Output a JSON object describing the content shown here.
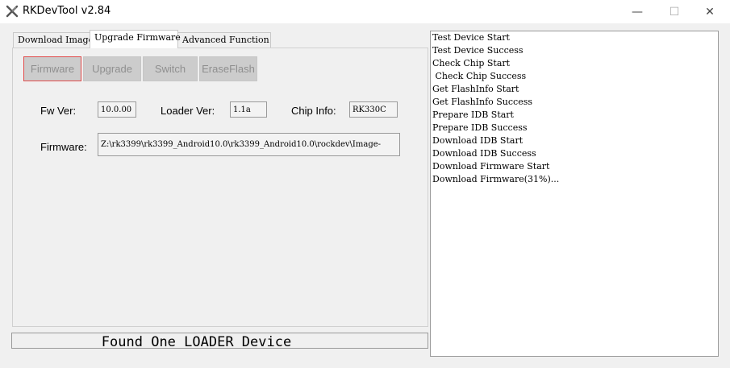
{
  "window": {
    "title": "RKDevTool v2.84",
    "minimize_glyph": "—",
    "maximize_glyph": "☐",
    "close_glyph": "✕"
  },
  "tabs": [
    {
      "label": "Download Image",
      "active": false
    },
    {
      "label": "Upgrade Firmware",
      "active": true
    },
    {
      "label": "Advanced Function",
      "active": false
    }
  ],
  "toolbar": {
    "firmware_label": "Firmware",
    "upgrade_label": "Upgrade",
    "switch_label": "Switch",
    "eraseflash_label": "EraseFlash"
  },
  "info": {
    "fw_ver_label": "Fw Ver:",
    "fw_ver_value": "10.0.00",
    "loader_ver_label": "Loader Ver:",
    "loader_ver_value": "1.1a",
    "chip_info_label": "Chip Info:",
    "chip_info_value": "RK330C",
    "firmware_label": "Firmware:",
    "firmware_path": "Z:\\rk3399\\rk3399_Android10.0\\rk3399_Android10.0\\rockdev\\Image-"
  },
  "status": {
    "text": "Found One LOADER Device"
  },
  "log": {
    "lines": [
      "Test Device Start",
      "Test Device Success",
      "Check Chip Start",
      " Check Chip Success",
      "Get FlashInfo Start",
      "Get FlashInfo Success",
      "Prepare IDB Start",
      "Prepare IDB Success",
      "Download IDB Start",
      "Download IDB Success",
      "Download Firmware Start",
      "Download Firmware(31%)..."
    ]
  },
  "colors": {
    "focus_border": "#e14b4b",
    "disabled_button": "#cccccc",
    "window_bg": "#f0f0f0"
  }
}
